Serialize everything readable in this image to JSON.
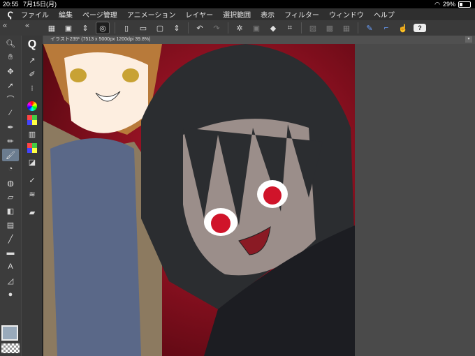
{
  "status": {
    "time": "20:55",
    "date": "7月15日(月)",
    "battery": "29%"
  },
  "menu": {
    "items": [
      "ファイル",
      "編集",
      "ページ管理",
      "アニメーション",
      "レイヤー",
      "選択範囲",
      "表示",
      "フィルター",
      "ウィンドウ",
      "ヘルプ"
    ]
  },
  "toolbar": {
    "icons": [
      "grid-view-icon",
      "new-file-icon",
      "spiral-icon",
      "page-icon",
      "folder-icon",
      "canvas-icon",
      "arrows-icon",
      "undo-icon",
      "redo-icon",
      "sparkle-icon",
      "transform-icon",
      "eraser-icon",
      "crop-icon",
      "hatch-icon",
      "fill-icon",
      "select-icon",
      "pen-icon",
      "snap-icon",
      "tap-icon",
      "help-icon"
    ],
    "help": "?"
  },
  "document": {
    "tab_title": "イラスト239* (7513 x 5000px 1200dpi 39.8%)"
  },
  "colors": {
    "accent": "#6b7c8f",
    "background": "#474747",
    "canvas_bg": "#8a1020"
  },
  "text_tool": "A"
}
